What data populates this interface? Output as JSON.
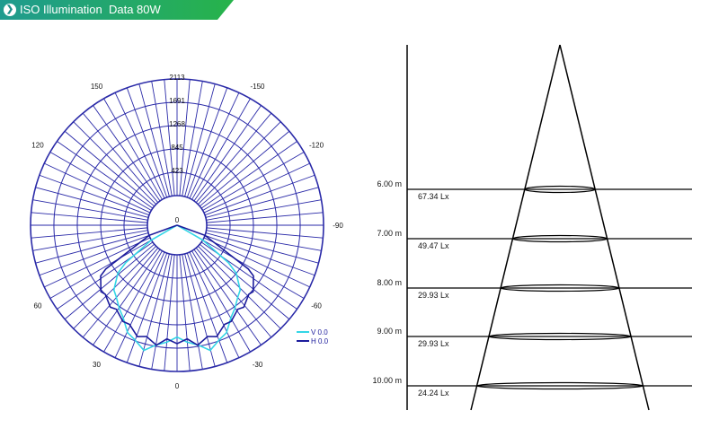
{
  "banner": {
    "icon": "chevron-right-icon",
    "title": "ISO Illumination  Data",
    "power": "80W",
    "color_start": "#1f9b8f",
    "color_end": "#27b34a"
  },
  "polar": {
    "radial_labels": [
      "2113",
      "1691",
      "1268",
      "845",
      "423",
      "0"
    ],
    "angle_labels": [
      "-150",
      "150",
      "-120",
      "120",
      "-90",
      "-60",
      "60",
      "-30",
      "30",
      "0"
    ],
    "legend": [
      "V 0.0",
      "H 0.0"
    ],
    "grid_color": "#2a2aa8",
    "v_color": "#33d6e6",
    "h_color": "#1c1c9c"
  },
  "chart_data": {
    "type": "polar",
    "radial_max": 2113,
    "radial_ticks": [
      423,
      845,
      1268,
      1691,
      2113
    ],
    "angular_step_deg": 5,
    "series": [
      {
        "name": "V 0.0",
        "angle_deg": [
          -60,
          -55,
          -50,
          -45,
          -40,
          -35,
          -30,
          -25,
          -20,
          -15,
          -10,
          -5,
          0,
          5,
          10,
          15,
          20,
          25,
          30,
          35,
          40,
          45,
          50,
          55,
          60
        ],
        "value": [
          0,
          600,
          860,
          1080,
          1180,
          1280,
          1420,
          1580,
          1700,
          1780,
          1700,
          1560,
          1520,
          1560,
          1700,
          1780,
          1700,
          1580,
          1420,
          1280,
          1180,
          1080,
          860,
          600,
          0
        ]
      },
      {
        "name": "H 0.0",
        "angle_deg": [
          -70,
          -60,
          -55,
          -50,
          -45,
          -40,
          -35,
          -30,
          -25,
          -20,
          -15,
          -10,
          -5,
          0,
          5,
          10,
          15,
          20,
          25,
          30,
          35,
          40,
          45,
          50,
          55,
          60,
          70
        ],
        "value": [
          0,
          950,
          1150,
          1260,
          1300,
          1340,
          1380,
          1420,
          1500,
          1560,
          1600,
          1620,
          1580,
          1560,
          1580,
          1620,
          1600,
          1560,
          1500,
          1420,
          1380,
          1340,
          1300,
          1260,
          1150,
          950,
          0
        ]
      }
    ]
  },
  "cone": {
    "rows": [
      {
        "height": "6.00 m",
        "lux": "67.34 Lx"
      },
      {
        "height": "7.00 m",
        "lux": "49.47 Lx"
      },
      {
        "height": "8.00 m",
        "lux": "29.93 Lx"
      },
      {
        "height": "9.00 m",
        "lux": "29.93 Lx"
      },
      {
        "height": "10.00 m",
        "lux": "24.24 Lx"
      }
    ]
  }
}
